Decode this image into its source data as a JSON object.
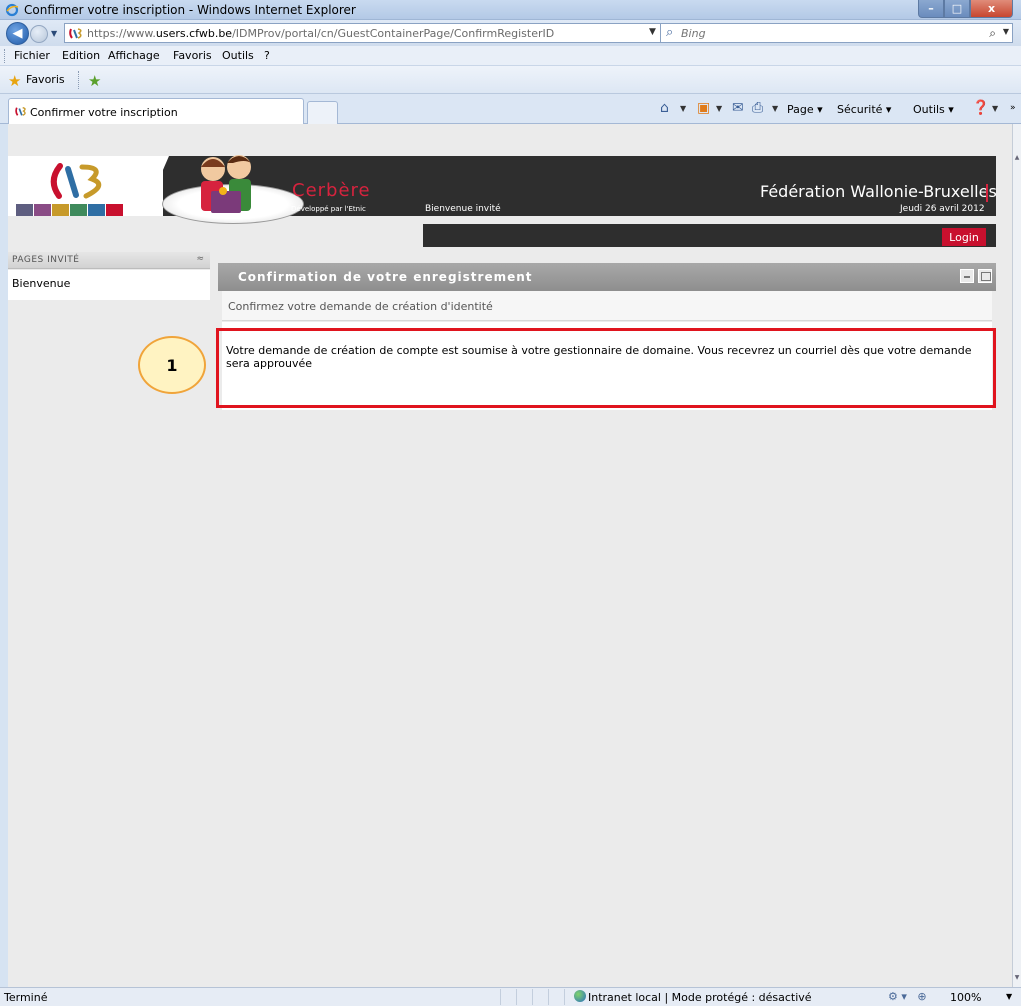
{
  "window": {
    "title": "Confirmer votre inscription - Windows Internet Explorer",
    "buttons": {
      "minimize": "–",
      "maximize": "□",
      "close": "x"
    }
  },
  "address": {
    "url_prefix": "https://www.",
    "url_domain": "users.cfwb.be",
    "url_path": "/IDMProv/portal/cn/GuestContainerPage/ConfirmRegisterID",
    "search_placeholder": "Bing"
  },
  "menu": {
    "items": [
      "Fichier",
      "Edition",
      "Affichage",
      "Favoris",
      "Outils",
      "?"
    ]
  },
  "favorites": {
    "label": "Favoris"
  },
  "tabs": {
    "active_label": "Confirmer votre inscription",
    "commands": {
      "page": "Page",
      "security": "Sécurité",
      "tools": "Outils"
    }
  },
  "page": {
    "header": {
      "app_name": "Cerbère",
      "developer": "Développé par l'Etnic",
      "welcome": "Bienvenue invité",
      "federation": "Fédération Wallonie-Bruxelles",
      "date": "Jeudi 26 avril 2012",
      "login_label": "Login",
      "square_colors": [
        "#5e5e80",
        "#8a4c86",
        "#c79a2a",
        "#3f8a5c",
        "#2f6ea4",
        "#c8102e"
      ]
    },
    "sidebar": {
      "title": "PAGES INVITÉ",
      "items": [
        "Bienvenue"
      ]
    },
    "portlet": {
      "title": "Confirmation de votre enregistrement",
      "subtitle": "Confirmez votre demande de création d'identité",
      "message": "Votre demande de création de compte est soumise à votre gestionnaire de domaine. Vous recevrez un courriel dès que votre demande sera approuvée"
    },
    "annotation": {
      "number": "1"
    }
  },
  "status": {
    "text": "Terminé",
    "zone": "Intranet local | Mode protégé : désactivé",
    "zoom": "100%"
  },
  "colors": {
    "accent_red": "#c8102e",
    "header_dark": "#2e2e2e",
    "annotation_red": "#e0141e",
    "callout_fill": "#fff3c2"
  }
}
